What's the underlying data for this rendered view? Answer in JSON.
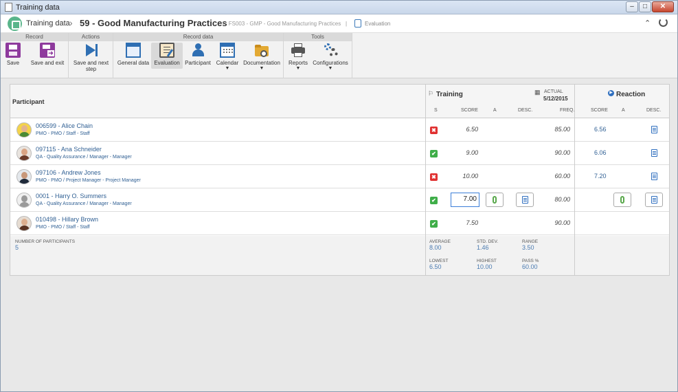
{
  "window": {
    "title": "Training data"
  },
  "header": {
    "breadcrumb_root": "Training data",
    "record_title": "59 - Good Manufacturing Practices",
    "record_code": "FS003 - GMP - Good Manufacturing Practices",
    "current_section": "Evaluation"
  },
  "ribbon": {
    "groups": [
      {
        "label": "Record"
      },
      {
        "label": "Actions"
      },
      {
        "label": "Record data"
      },
      {
        "label": "Tools"
      }
    ],
    "buttons": {
      "save": "Save",
      "save_exit": "Save and exit",
      "save_next_1": "Save and next",
      "save_next_2": "step",
      "general_data": "General data",
      "evaluation": "Evaluation",
      "participant": "Participant",
      "calendar": "Calendar",
      "documentation": "Documentation",
      "reports": "Reports",
      "configurations": "Configurations"
    }
  },
  "grid": {
    "participant_header": "Participant",
    "training": {
      "title": "Training",
      "actual_label": "ACTUAL",
      "actual_date": "5/12/2015",
      "cols": {
        "s": "S",
        "score": "SCORE",
        "a": "A",
        "desc": "DESC.",
        "freq": "FREQ."
      }
    },
    "reaction": {
      "title": "Reaction",
      "cols": {
        "score": "SCORE",
        "a": "A",
        "desc": "DESC."
      }
    },
    "rows": [
      {
        "name": "006599 - Alice Chain",
        "role": "PMO - PMO / Staff - Staff",
        "status": "fail",
        "score": "6.50",
        "freq": "85.00",
        "reaction_score": "6.56"
      },
      {
        "name": "097115 - Ana Schneider",
        "role": "QA - Quality Assurance / Manager - Manager",
        "status": "pass",
        "score": "9.00",
        "freq": "90.00",
        "reaction_score": "6.06"
      },
      {
        "name": "097106 - Andrew Jones",
        "role": "PMO - PMO / Project Manager - Project Manager",
        "status": "fail",
        "score": "10.00",
        "freq": "60.00",
        "reaction_score": "7.20"
      },
      {
        "name": "0001 - Harry O. Summers",
        "role": "QA - Quality Assurance / Manager - Manager",
        "status": "pass",
        "score": "7.00",
        "freq": "80.00",
        "reaction_score": ""
      },
      {
        "name": "010498 - Hillary Brown",
        "role": "PMO - PMO / Staff - Staff",
        "status": "pass",
        "score": "7.50",
        "freq": "90.00",
        "reaction_score": ""
      }
    ]
  },
  "stats": {
    "participants_label": "NUMBER OF PARTICIPANTS",
    "participants": "5",
    "average_label": "AVERAGE",
    "average": "8.00",
    "stddev_label": "STD. DEV.",
    "stddev": "1.46",
    "range_label": "RANGE",
    "range": "3.50",
    "lowest_label": "LOWEST",
    "lowest": "6.50",
    "highest_label": "HIGHEST",
    "highest": "10.00",
    "pass_label": "PASS %",
    "pass": "60.00"
  },
  "colors": {
    "accent": "#2f5f93",
    "pass": "#3fae49",
    "fail": "#e03131",
    "logo": "#5ab58b"
  }
}
